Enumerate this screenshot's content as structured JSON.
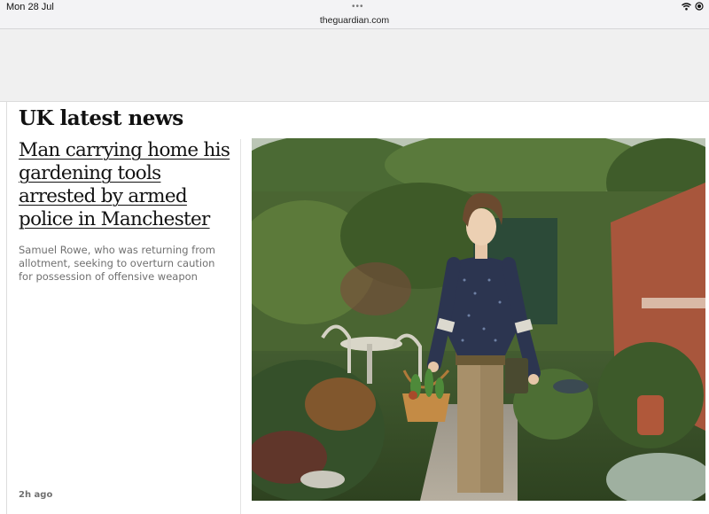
{
  "status_bar": {
    "time": "Mon 28 Jul",
    "icons": [
      "wifi-icon",
      "battery-icon"
    ]
  },
  "browser": {
    "url": "theguardian.com",
    "menu_dots": "•••"
  },
  "section": {
    "title": "UK latest news"
  },
  "article": {
    "headline": "Man carrying home his gardening tools arrested by armed police in Manchester",
    "standfirst": "Samuel Rowe, who was returning from allotment, seeking to overturn caution for possession of offensive weapon",
    "timestamp": "2h ago",
    "image": "photo of a man in a garden holding a basket of plants"
  },
  "colors": {
    "text": "#121212",
    "muted": "#707070",
    "background": "#ffffff"
  }
}
